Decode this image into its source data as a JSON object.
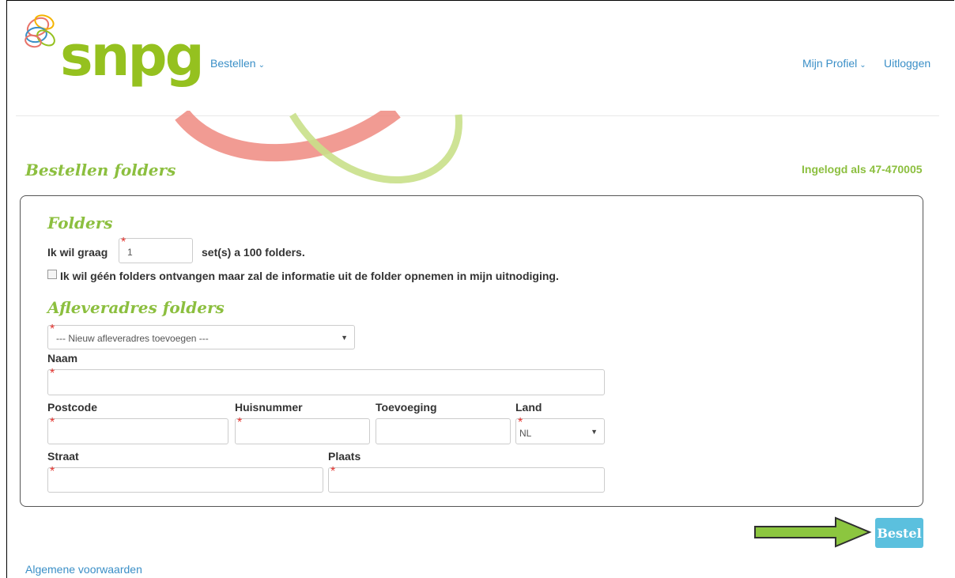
{
  "brand": {
    "logo_text": "snpg",
    "accent": "#95c11f",
    "link_color": "#3a8fc7"
  },
  "nav": {
    "bestellen": "Bestellen",
    "mijn_profiel": "Mijn Profiel",
    "uitloggen": "Uitloggen"
  },
  "page": {
    "title": "Bestellen folders",
    "login_status": "Ingelogd als 47-470005"
  },
  "folders": {
    "heading": "Folders",
    "want_label": "Ik wil graag",
    "quantity_value": "1",
    "sets_label": "set(s) a 100 folders.",
    "no_folders_label": "Ik wil géén folders ontvangen maar zal de informatie uit de folder opnemen in mijn uitnodiging.",
    "no_folders_checked": false
  },
  "address": {
    "heading": "Afleveradres folders",
    "select_value": "--- Nieuw afleveradres toevoegen ---",
    "naam_label": "Naam",
    "postcode_label": "Postcode",
    "huisnummer_label": "Huisnummer",
    "toevoeging_label": "Toevoeging",
    "land_label": "Land",
    "land_value": "NL",
    "straat_label": "Straat",
    "plaats_label": "Plaats",
    "required_marker": "*"
  },
  "actions": {
    "bestel": "Bestel",
    "bestel_color": "#5bc0de"
  },
  "footer": {
    "voorwaarden": "Algemene voorwaarden"
  }
}
